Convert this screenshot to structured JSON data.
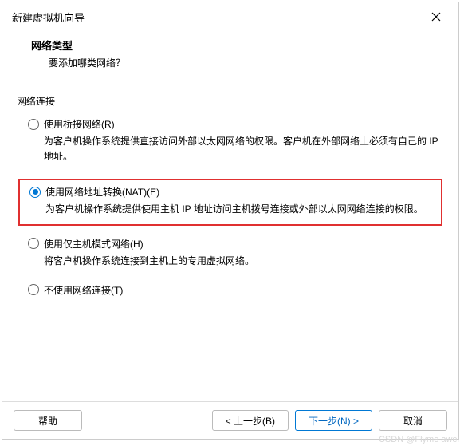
{
  "titlebar": {
    "title": "新建虚拟机向导"
  },
  "header": {
    "title": "网络类型",
    "subtitle": "要添加哪类网络？"
  },
  "group": {
    "label": "网络连接"
  },
  "options": {
    "bridged": {
      "label": "使用桥接网络(R)",
      "desc": "为客户机操作系统提供直接访问外部以太网网络的权限。客户机在外部网络上必须有自己的 IP 地址。"
    },
    "nat": {
      "label": "使用网络地址转换(NAT)(E)",
      "desc": "为客户机操作系统提供使用主机 IP 地址访问主机拨号连接或外部以太网网络连接的权限。"
    },
    "hostonly": {
      "label": "使用仅主机模式网络(H)",
      "desc": "将客户机操作系统连接到主机上的专用虚拟网络。"
    },
    "none": {
      "label": "不使用网络连接(T)"
    }
  },
  "buttons": {
    "help": "帮助",
    "back": "< 上一步(B)",
    "next": "下一步(N) >",
    "cancel": "取消"
  },
  "watermark": "CSDN @Flyme awei"
}
